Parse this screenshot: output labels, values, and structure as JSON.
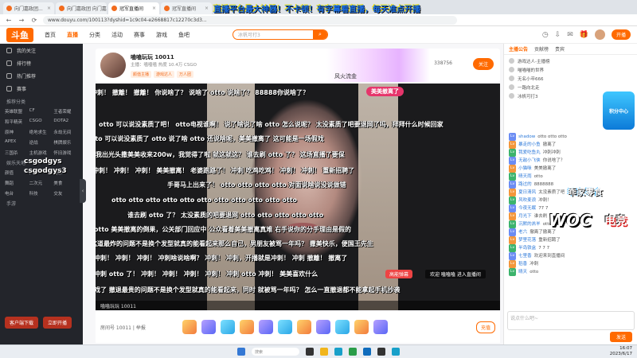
{
  "overlay_title": "直播平台最大神器！不卡顿！有字幕看直播，每天准点开播",
  "browser": {
    "tabs": [
      "向门嘉政团...",
      "向门嘉政团 向门嘉政团",
      "冠军直播间",
      "冠军直播间"
    ],
    "url": "www.douyu.com/100113?dyshid=1c9c04-e2668817c12270c3d3...",
    "back": "←",
    "forward": "→",
    "reload": "⟳"
  },
  "site": {
    "logo": "斗鱼",
    "nav": [
      "首页",
      "直播",
      "分类",
      "活动",
      "赛事",
      "游戏",
      "鱼吧"
    ],
    "search_placeholder": "冰帆可打3",
    "start_live": "开播"
  },
  "sidebar": {
    "top_items": [
      "我的关注",
      "排行榜",
      "热门推荐",
      "赛事"
    ],
    "section1": "推荐分类",
    "grid1": [
      "英雄联盟",
      "CF",
      "王者荣耀",
      "和平精英",
      "CSGO",
      "DOTA2",
      "原神",
      "绝地求生",
      "永劫无间",
      "APEX",
      "逆战",
      "棋牌娱乐",
      "三国杀",
      "主机游戏",
      "怀旧游戏"
    ],
    "section2": "娱乐天地",
    "grid2": [
      "颜值",
      "户外",
      "音乐",
      "舞蹈",
      "二次元",
      "美食",
      "电台",
      "科技",
      "交友"
    ],
    "section3": "手游",
    "buttons": [
      "客户端下载",
      "立即开播"
    ],
    "csgo_1": "csgodgys",
    "csgo_2": "csgodgys3"
  },
  "room": {
    "name": "嗑嗑玩玩 10011",
    "meta": "主播：嗑嗑嗑  热度 10.4万  CSGO",
    "tags": [
      "颜值主播",
      "游戏达人",
      "万人团"
    ],
    "follow": "关注",
    "follow_count": "338756",
    "banner_text": "风火流金"
  },
  "video": {
    "top_tag": "美美撤离了",
    "danmaku": [
      "冲刺！ 撤離！ 撤離！ 你说啥了？ 说啥了 otto 说啥了？ 88888你说啥了？",
      "otto 可以说没素质了吧！ otto电视谁啊！ 说了啥说了啥 otto 怎么说呢？ 太没素质了吧要退网了吗，拜拜什么时候回家",
      "otto 可以说没素质了 otto 说了啥 otto 还说啥呢，美美撤离了 这可能是一场假戏",
      "我出光头撒美美收来200w，我觉得了啦 就这就这？ 谁去刷 otto 了？ 这场直播了要保",
      "冲刺！ 冲刺！ 冲刺！ 美美撤离！ 老婆跑路了！ 冲刺 吃鸡吃鸡！ 冲刺！ 冲刺！ 重新招聘了",
      "手哥马上出来了！ otto otto otto otto 对面说啥说没说做错",
      "otto otto otto otto otto otto otto otto otto otto otto",
      "谁去刷 otto 了？ 太没素质的吧要退网 otto otto otto otto otto",
      "otto 美美撤离的倒果，公关部门回应中 公众看着美美撤离真难 右手说你的分手理由是假的",
      "这道最炸的问题不是换个发型就真的能看起来那么自己，男朋友被骂一年吗？ 撒美快乐，便国王先生",
      "冲刺！ 冲刺！ 冲刺！ 冲刺啥说啥啊？ 冲刺！ 冲刺，开播就是冲刺！ 冲刺 撤離！ 撤离了",
      "冲刺 otto 了！ 冲刺！ 冲刺！ 冲刺！ 冲刺！ 冲刺 otto 冲刺！ 美美喜欢什么",
      "戏了 撤退最贵的问题不是换个发型就真的能看起来，同时 就被骂一年吗？ 怎么一直撤退都不能拿起手机抄袭"
    ],
    "fire_label": "高能弹幕",
    "toast": "欢迎 嗑嗑嗑 进入直播间",
    "room_id_bar": "嗑嗑玩玩 10011"
  },
  "gifts": {
    "room_id": "房间号 10011  |  举报",
    "recharge": "充值"
  },
  "right": {
    "tabs": [
      "主播公告",
      "贡献榜",
      "贵宾"
    ],
    "ranks": [
      "游戏达人-主播榜",
      "喵喵喵的世界",
      "无名小卒666",
      "一路向北走",
      "冰帆可打3"
    ],
    "chat": [
      {
        "name": "shadow",
        "text": "otto otto otto"
      },
      {
        "name": "暴走的小鱼",
        "text": "撤离了"
      },
      {
        "name": "我爱吃鱼丸",
        "text": "冲刺冲刺"
      },
      {
        "name": "无敌小飞侠",
        "text": "你说啥了？"
      },
      {
        "name": "小猫咪",
        "text": "美美撤离了"
      },
      {
        "name": "晴天雨",
        "text": "otto"
      },
      {
        "name": "路过的",
        "text": "8888888"
      },
      {
        "name": "夏日清风",
        "text": "太没素质了吧"
      },
      {
        "name": "风吹麦浪",
        "text": "冲刺！"
      },
      {
        "name": "今夜无眠",
        "text": "77 7"
      },
      {
        "name": "月光下",
        "text": "谁去刷"
      },
      {
        "name": "沉默的羔羊",
        "text": "otto otto"
      },
      {
        "name": "老六",
        "text": "撤离了撤离了"
      },
      {
        "name": "梦里花落",
        "text": "重新招聘了"
      },
      {
        "name": "半岛铁盒",
        "text": "7 7 7"
      },
      {
        "name": "七里香",
        "text": "欢迎来到直播间"
      },
      {
        "name": "稻香",
        "text": "冲刺"
      },
      {
        "name": "晴天",
        "text": "otto"
      }
    ],
    "promo": "积分中心",
    "tiktok": "乖家零食",
    "woc": "WOC",
    "woc_sub": "电竞",
    "input_placeholder": "说点什么吧~",
    "send": "发送"
  },
  "taskbar": {
    "search": "搜索",
    "time": "16:07",
    "date": "2023/6/17"
  }
}
